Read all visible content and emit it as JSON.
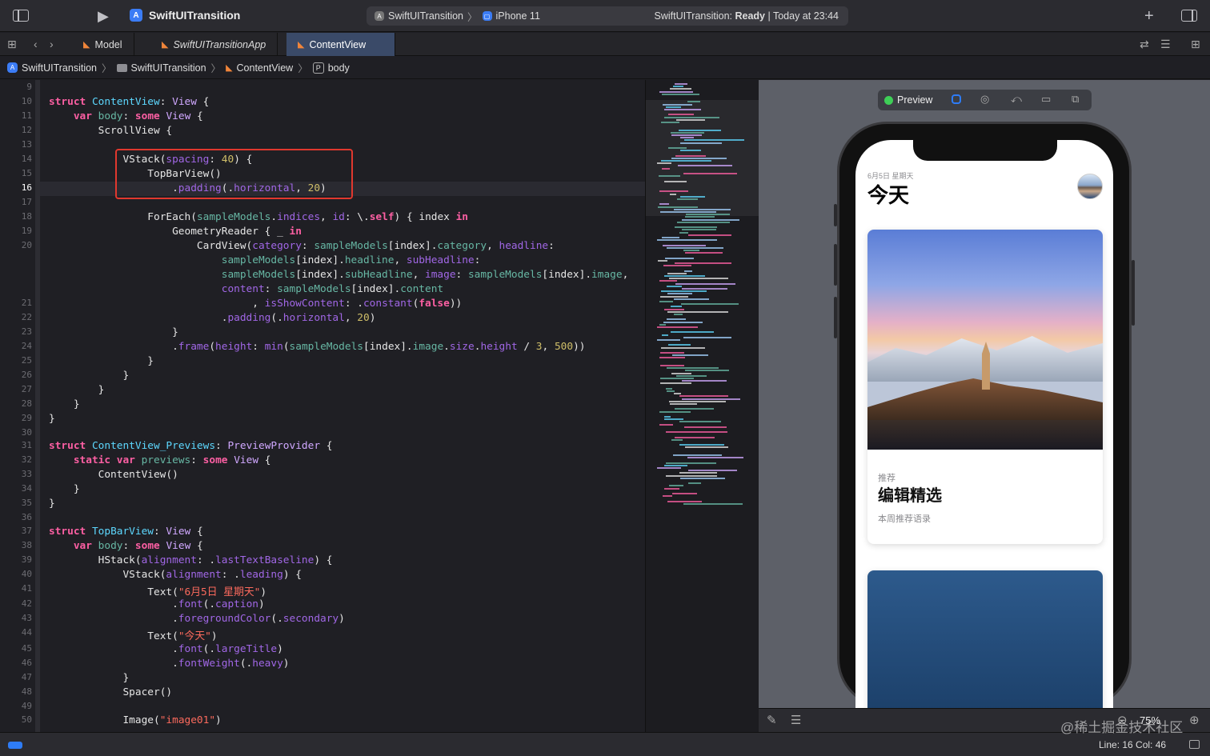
{
  "toolbar": {
    "project_title": "SwiftUITransition",
    "scheme": "SwiftUITransition",
    "destination": "iPhone 11",
    "status_prefix": "SwiftUITransition: ",
    "status_state": "Ready",
    "status_suffix": " | Today at 23:44"
  },
  "tabs": [
    {
      "label": "Model"
    },
    {
      "label": "SwiftUITransitionApp"
    },
    {
      "label": "ContentView"
    }
  ],
  "breadcrumb": [
    "SwiftUITransition",
    "SwiftUITransition",
    "ContentView",
    "body"
  ],
  "editor": {
    "current_line": 16,
    "lines": [
      {
        "n": "9"
      },
      {
        "n": "10"
      },
      {
        "n": "11"
      },
      {
        "n": "12"
      },
      {
        "n": "13"
      },
      {
        "n": "14"
      },
      {
        "n": "15"
      },
      {
        "n": "16"
      },
      {
        "n": "17"
      },
      {
        "n": "18"
      },
      {
        "n": "19"
      },
      {
        "n": "20"
      },
      {
        "n": ""
      },
      {
        "n": ""
      },
      {
        "n": ""
      },
      {
        "n": "21"
      },
      {
        "n": "22"
      },
      {
        "n": "23"
      },
      {
        "n": "24"
      },
      {
        "n": "25"
      },
      {
        "n": "26"
      },
      {
        "n": "27"
      },
      {
        "n": "28"
      },
      {
        "n": "29"
      },
      {
        "n": "30"
      },
      {
        "n": "31"
      },
      {
        "n": "32"
      },
      {
        "n": "33"
      },
      {
        "n": "34"
      },
      {
        "n": "35"
      },
      {
        "n": "36"
      },
      {
        "n": "37"
      },
      {
        "n": "38"
      },
      {
        "n": "39"
      },
      {
        "n": "40"
      },
      {
        "n": "41"
      },
      {
        "n": "42"
      },
      {
        "n": "43"
      },
      {
        "n": "44"
      },
      {
        "n": "45"
      },
      {
        "n": "46"
      },
      {
        "n": "47"
      },
      {
        "n": "48"
      },
      {
        "n": "49"
      },
      {
        "n": "50"
      }
    ]
  },
  "preview": {
    "label": "Preview",
    "zoom": "75%",
    "date": "6月5日 星期天",
    "title": "今天",
    "card": {
      "category": "推荐",
      "headline": "编辑精选",
      "sub_headline": "本周推荐语录"
    }
  },
  "status": {
    "cursor": "Line: 16  Col: 46"
  },
  "watermark": "@稀土掘金技术社区",
  "colors": {
    "keyword": "#fc5fa3",
    "type": "#d0a8ff",
    "string": "#fc6a5d",
    "number": "#d0bf69",
    "accent": "#2e7cf6",
    "highlight_box": "#e0382e"
  },
  "icons": [
    "sidebar-toggle-icon",
    "run-icon",
    "app-icon",
    "add-icon",
    "inspector-toggle-icon",
    "grid-icon",
    "back-icon",
    "forward-icon",
    "swift-file-icon",
    "folder-icon",
    "property-icon",
    "live-preview-icon",
    "pin-icon",
    "zoom-in-icon",
    "zoom-out-icon"
  ]
}
